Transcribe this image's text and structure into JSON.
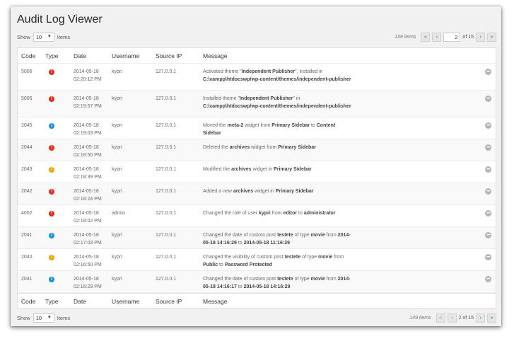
{
  "page_title": "Audit Log Viewer",
  "top_bar": {
    "show_label": "Show",
    "per_page": "10",
    "items_label": "Items",
    "total_items": "149 items",
    "first_btn": "«",
    "prev_btn": "‹",
    "page_value": "2",
    "of_pages": "of 15",
    "next_btn": "›",
    "last_btn": "»"
  },
  "bottom_bar": {
    "show_label": "Show",
    "per_page": "10",
    "items_label": "Items",
    "total_items": "149 items",
    "first_btn": "«",
    "prev_btn": "‹",
    "page_text": "2 of 15",
    "next_btn": "›",
    "last_btn": "»"
  },
  "columns": {
    "code": "Code",
    "type": "Type",
    "date": "Date",
    "username": "Username",
    "source_ip": "Source IP",
    "message": "Message"
  },
  "severity_colors": {
    "critical": "#dd2d1f",
    "warning": "#e6a700",
    "notice": "#1f8ed8"
  },
  "rows": [
    {
      "code": "5006",
      "type": "critical",
      "date": "2014-05-18",
      "time": "02:20:12 PM",
      "username": "kypri",
      "ip": "127.0.0.1",
      "message": [
        {
          "t": "Activated theme \""
        },
        {
          "t": "Independent Publisher",
          "b": true
        },
        {
          "t": "\", installed in "
        },
        {
          "t": "C:\\xampp\\htdocswp/wp-content/themes/independent-publisher",
          "b": true
        }
      ]
    },
    {
      "code": "5005",
      "type": "critical",
      "date": "2014-05-18",
      "time": "02:19:57 PM",
      "username": "kypri",
      "ip": "127.0.0.1",
      "message": [
        {
          "t": "Installed theme \""
        },
        {
          "t": "Independent Publisher",
          "b": true
        },
        {
          "t": "\" in "
        },
        {
          "t": "C:\\xampp\\htdocswp/wp-content/themes/independent-publisher",
          "b": true
        }
      ]
    },
    {
      "code": "2045",
      "type": "notice",
      "date": "2014-05-18",
      "time": "02:19:03 PM",
      "username": "kypri",
      "ip": "127.0.0.1",
      "message": [
        {
          "t": "Moved the "
        },
        {
          "t": "meta-2",
          "b": true
        },
        {
          "t": " widget from "
        },
        {
          "t": "Primary Sidebar",
          "b": true
        },
        {
          "t": " to "
        },
        {
          "t": "Content Sidebar",
          "b": true
        }
      ]
    },
    {
      "code": "2044",
      "type": "critical",
      "date": "2014-05-18",
      "time": "02:18:50 PM",
      "username": "kypri",
      "ip": "127.0.0.1",
      "message": [
        {
          "t": "Deleted the "
        },
        {
          "t": "archives",
          "b": true
        },
        {
          "t": " widget from "
        },
        {
          "t": "Primary Sidebar",
          "b": true
        }
      ]
    },
    {
      "code": "2043",
      "type": "warning",
      "date": "2014-05-18",
      "time": "02:18:39 PM",
      "username": "kypri",
      "ip": "127.0.0.1",
      "message": [
        {
          "t": "Modified the "
        },
        {
          "t": "archives",
          "b": true
        },
        {
          "t": " widget in "
        },
        {
          "t": "Primary Sidebar",
          "b": true
        }
      ]
    },
    {
      "code": "2042",
      "type": "critical",
      "date": "2014-05-18",
      "time": "02:18:24 PM",
      "username": "kypri",
      "ip": "127.0.0.1",
      "message": [
        {
          "t": "Added a new "
        },
        {
          "t": "archives",
          "b": true
        },
        {
          "t": " widget in "
        },
        {
          "t": "Primary Sidebar",
          "b": true
        }
      ]
    },
    {
      "code": "4002",
      "type": "critical",
      "date": "2014-05-18",
      "time": "02:18:02 PM",
      "username": "admin",
      "ip": "127.0.0.1",
      "message": [
        {
          "t": "Changed the role of user "
        },
        {
          "t": "kypri",
          "b": true
        },
        {
          "t": " from "
        },
        {
          "t": "editor",
          "b": true
        },
        {
          "t": " to "
        },
        {
          "t": "administrator",
          "b": true
        }
      ]
    },
    {
      "code": "2041",
      "type": "notice",
      "date": "2014-05-18",
      "time": "02:17:03 PM",
      "username": "kypri",
      "ip": "127.0.0.1",
      "message": [
        {
          "t": "Changed the date of custom post "
        },
        {
          "t": "testete",
          "b": true
        },
        {
          "t": " of type "
        },
        {
          "t": "movie",
          "b": true
        },
        {
          "t": " from "
        },
        {
          "t": "2014-05-18 14:16:29",
          "b": true
        },
        {
          "t": " to "
        },
        {
          "t": "2014-05-18 11:16:29",
          "b": true
        }
      ]
    },
    {
      "code": "2040",
      "type": "warning",
      "date": "2014-05-18",
      "time": "02:16:50 PM",
      "username": "kypri",
      "ip": "127.0.0.1",
      "message": [
        {
          "t": "Changed the visibility of custom post "
        },
        {
          "t": "testete",
          "b": true
        },
        {
          "t": " of type "
        },
        {
          "t": "movie",
          "b": true
        },
        {
          "t": " from "
        },
        {
          "t": "Public",
          "b": true
        },
        {
          "t": " to "
        },
        {
          "t": "Password Protected",
          "b": true
        }
      ]
    },
    {
      "code": "2041",
      "type": "notice",
      "date": "2014-05-18",
      "time": "02:16:29 PM",
      "username": "kypri",
      "ip": "127.0.0.1",
      "message": [
        {
          "t": "Changed the date of custom post "
        },
        {
          "t": "testete",
          "b": true
        },
        {
          "t": " of type "
        },
        {
          "t": "movie",
          "b": true
        },
        {
          "t": " from "
        },
        {
          "t": "2014-05-18 14:16:17",
          "b": true
        },
        {
          "t": " to "
        },
        {
          "t": "2014-05-18 14:16:29",
          "b": true
        }
      ]
    }
  ]
}
